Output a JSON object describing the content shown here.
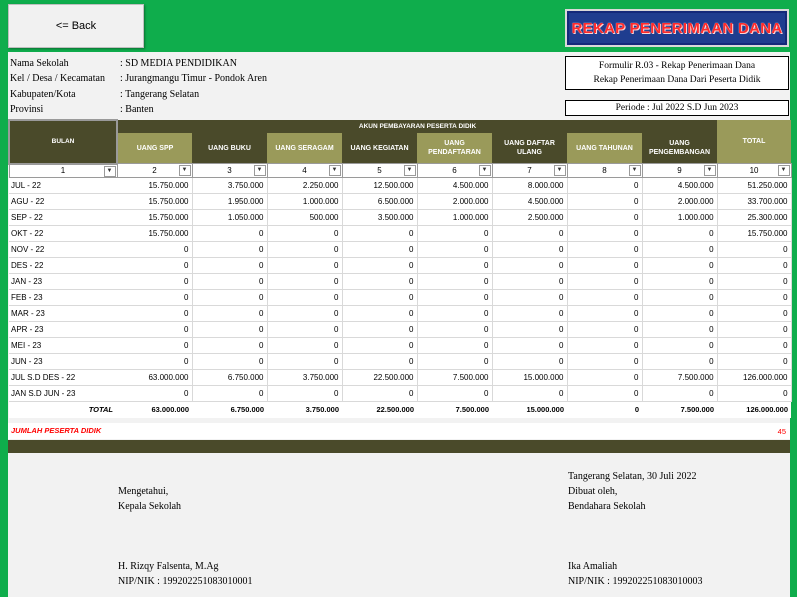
{
  "back_button": "<= Back",
  "banner_title": "REKAP PENERIMAAN DANA",
  "info": [
    {
      "label": "Nama Sekolah",
      "value": ": SD MEDIA PENDIDIKAN"
    },
    {
      "label": "Kel / Desa / Kecamatan",
      "value": ": Jurangmangu Timur - Pondok Aren"
    },
    {
      "label": "Kabupaten/Kota",
      "value": ": Tangerang Selatan"
    },
    {
      "label": "Provinsi",
      "value": ": Banten"
    }
  ],
  "form_box": {
    "line1": "Formulir R.03 - Rekap Penerimaan Dana",
    "line2": "Rekap Penerimaan Dana Dari Peserta Didik"
  },
  "periode": "Periode : Jul 2022 S.D Jun 2023",
  "table": {
    "bulan_header": "BULAN",
    "group_header": "AKUN PEMBAYARAN PESERTA DIDIK",
    "total_header": "TOTAL",
    "columns": [
      "UANG SPP",
      "UANG BUKU",
      "UANG SERAGAM",
      "UANG KEGIATAN",
      "UANG PENDAFTARAN",
      "UANG DAFTAR ULANG",
      "UANG TAHUNAN",
      "UANG PENGEMBANGAN"
    ],
    "col_numbers": [
      "1",
      "2",
      "3",
      "4",
      "5",
      "6",
      "7",
      "8",
      "9",
      "10"
    ],
    "rows": [
      {
        "month": "JUL - 22",
        "vals": [
          "15.750.000",
          "3.750.000",
          "2.250.000",
          "12.500.000",
          "4.500.000",
          "8.000.000",
          "0",
          "4.500.000",
          "51.250.000"
        ]
      },
      {
        "month": "AGU - 22",
        "vals": [
          "15.750.000",
          "1.950.000",
          "1.000.000",
          "6.500.000",
          "2.000.000",
          "4.500.000",
          "0",
          "2.000.000",
          "33.700.000"
        ]
      },
      {
        "month": "SEP - 22",
        "vals": [
          "15.750.000",
          "1.050.000",
          "500.000",
          "3.500.000",
          "1.000.000",
          "2.500.000",
          "0",
          "1.000.000",
          "25.300.000"
        ]
      },
      {
        "month": "OKT - 22",
        "vals": [
          "15.750.000",
          "0",
          "0",
          "0",
          "0",
          "0",
          "0",
          "0",
          "15.750.000"
        ]
      },
      {
        "month": "NOV - 22",
        "vals": [
          "0",
          "0",
          "0",
          "0",
          "0",
          "0",
          "0",
          "0",
          "0"
        ]
      },
      {
        "month": "DES - 22",
        "vals": [
          "0",
          "0",
          "0",
          "0",
          "0",
          "0",
          "0",
          "0",
          "0"
        ]
      },
      {
        "month": "JAN - 23",
        "vals": [
          "0",
          "0",
          "0",
          "0",
          "0",
          "0",
          "0",
          "0",
          "0"
        ]
      },
      {
        "month": "FEB - 23",
        "vals": [
          "0",
          "0",
          "0",
          "0",
          "0",
          "0",
          "0",
          "0",
          "0"
        ]
      },
      {
        "month": "MAR - 23",
        "vals": [
          "0",
          "0",
          "0",
          "0",
          "0",
          "0",
          "0",
          "0",
          "0"
        ]
      },
      {
        "month": "APR - 23",
        "vals": [
          "0",
          "0",
          "0",
          "0",
          "0",
          "0",
          "0",
          "0",
          "0"
        ]
      },
      {
        "month": "MEI - 23",
        "vals": [
          "0",
          "0",
          "0",
          "0",
          "0",
          "0",
          "0",
          "0",
          "0"
        ]
      },
      {
        "month": "JUN - 23",
        "vals": [
          "0",
          "0",
          "0",
          "0",
          "0",
          "0",
          "0",
          "0",
          "0"
        ]
      },
      {
        "month": "JUL S.D DES - 22",
        "vals": [
          "63.000.000",
          "6.750.000",
          "3.750.000",
          "22.500.000",
          "7.500.000",
          "15.000.000",
          "0",
          "7.500.000",
          "126.000.000"
        ]
      },
      {
        "month": "JAN S.D JUN - 23",
        "vals": [
          "0",
          "0",
          "0",
          "0",
          "0",
          "0",
          "0",
          "0",
          "0"
        ]
      }
    ],
    "total_label": "TOTAL",
    "totals": [
      "63.000.000",
      "6.750.000",
      "3.750.000",
      "22.500.000",
      "7.500.000",
      "15.000.000",
      "0",
      "7.500.000",
      "126.000.000"
    ]
  },
  "jumlah_label": "JUMLAH PESERTA DIDIK",
  "jumlah_value": "45",
  "signature": {
    "left_line1": "Mengetahui,",
    "left_line2": "Kepala Sekolah",
    "left_name": "H. Rizqy Falsenta, M.Ag",
    "left_nip": "NIP/NIK : 199202251083010001",
    "right_place_date": "Tangerang Selatan, 30 Juli 2022",
    "right_line1": "Dibuat oleh,",
    "right_line2": "Bendahara Sekolah",
    "right_name": "Ika Amaliah",
    "right_nip": "NIP/NIK : 199202251083010003"
  },
  "colors": {
    "green": "#0fad4c",
    "dark_olive": "#4a4a2a",
    "olive": "#9a9a5a",
    "banner_blue": "#1f3d8f",
    "red": "#ff0000"
  }
}
